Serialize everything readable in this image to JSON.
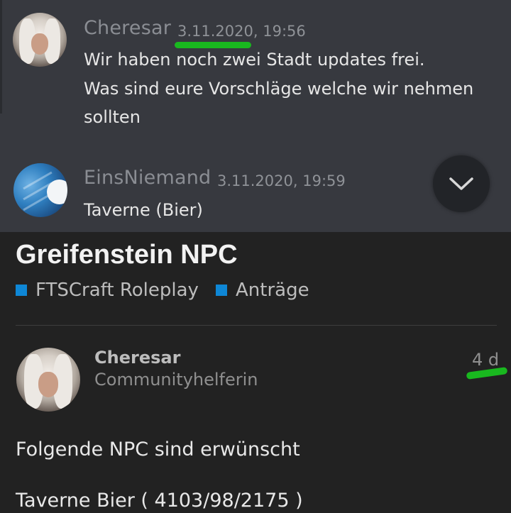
{
  "chat": {
    "messages": [
      {
        "username": "Cheresar",
        "timestamp": "3.11.2020, 19:56",
        "lines": [
          "Wir haben noch zwei Stadt updates frei.",
          "Was sind eure Vorschläge welche wir nehmen",
          "sollten"
        ]
      },
      {
        "username": "EinsNiemand",
        "timestamp": "3.11.2020, 19:59",
        "lines": [
          "Taverne (Bier)"
        ]
      }
    ],
    "scroll_icon": "chevron-down-icon"
  },
  "forum": {
    "topic_title": "Greifenstein NPC",
    "categories": [
      {
        "label": "FTSCraft Roleplay",
        "color": "#0e87d6"
      },
      {
        "label": "Anträge",
        "color": "#0e87d6"
      }
    ],
    "post": {
      "username": "Cheresar",
      "role": "Communityhelferin",
      "age": "4 d",
      "body": [
        "Folgende NPC sind erwünscht",
        "Taverne Bier ( 4103/98/2175 )"
      ]
    }
  },
  "colors": {
    "chat_bg": "#37393f",
    "forum_bg": "#222222",
    "annotation_green": "#19b81f",
    "category_blue": "#0e87d6"
  }
}
